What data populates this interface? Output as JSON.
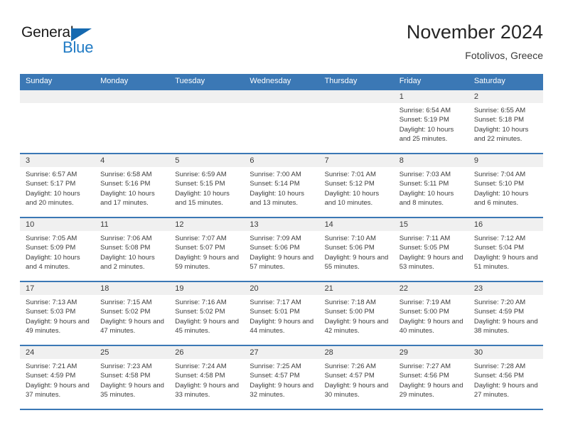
{
  "brand": {
    "name_part1": "General",
    "name_part2": "Blue"
  },
  "header": {
    "title": "November 2024",
    "location": "Fotolivos, Greece"
  },
  "colors": {
    "header_blue": "#3b78b5",
    "brand_blue": "#1f7ac4",
    "day_band": "#f0f0f0"
  },
  "weekdays": [
    "Sunday",
    "Monday",
    "Tuesday",
    "Wednesday",
    "Thursday",
    "Friday",
    "Saturday"
  ],
  "weeks": [
    [
      {
        "blank": true
      },
      {
        "blank": true
      },
      {
        "blank": true
      },
      {
        "blank": true
      },
      {
        "blank": true
      },
      {
        "day": "1",
        "sunrise": "Sunrise: 6:54 AM",
        "sunset": "Sunset: 5:19 PM",
        "daylight": "Daylight: 10 hours and 25 minutes."
      },
      {
        "day": "2",
        "sunrise": "Sunrise: 6:55 AM",
        "sunset": "Sunset: 5:18 PM",
        "daylight": "Daylight: 10 hours and 22 minutes."
      }
    ],
    [
      {
        "day": "3",
        "sunrise": "Sunrise: 6:57 AM",
        "sunset": "Sunset: 5:17 PM",
        "daylight": "Daylight: 10 hours and 20 minutes."
      },
      {
        "day": "4",
        "sunrise": "Sunrise: 6:58 AM",
        "sunset": "Sunset: 5:16 PM",
        "daylight": "Daylight: 10 hours and 17 minutes."
      },
      {
        "day": "5",
        "sunrise": "Sunrise: 6:59 AM",
        "sunset": "Sunset: 5:15 PM",
        "daylight": "Daylight: 10 hours and 15 minutes."
      },
      {
        "day": "6",
        "sunrise": "Sunrise: 7:00 AM",
        "sunset": "Sunset: 5:14 PM",
        "daylight": "Daylight: 10 hours and 13 minutes."
      },
      {
        "day": "7",
        "sunrise": "Sunrise: 7:01 AM",
        "sunset": "Sunset: 5:12 PM",
        "daylight": "Daylight: 10 hours and 10 minutes."
      },
      {
        "day": "8",
        "sunrise": "Sunrise: 7:03 AM",
        "sunset": "Sunset: 5:11 PM",
        "daylight": "Daylight: 10 hours and 8 minutes."
      },
      {
        "day": "9",
        "sunrise": "Sunrise: 7:04 AM",
        "sunset": "Sunset: 5:10 PM",
        "daylight": "Daylight: 10 hours and 6 minutes."
      }
    ],
    [
      {
        "day": "10",
        "sunrise": "Sunrise: 7:05 AM",
        "sunset": "Sunset: 5:09 PM",
        "daylight": "Daylight: 10 hours and 4 minutes."
      },
      {
        "day": "11",
        "sunrise": "Sunrise: 7:06 AM",
        "sunset": "Sunset: 5:08 PM",
        "daylight": "Daylight: 10 hours and 2 minutes."
      },
      {
        "day": "12",
        "sunrise": "Sunrise: 7:07 AM",
        "sunset": "Sunset: 5:07 PM",
        "daylight": "Daylight: 9 hours and 59 minutes."
      },
      {
        "day": "13",
        "sunrise": "Sunrise: 7:09 AM",
        "sunset": "Sunset: 5:06 PM",
        "daylight": "Daylight: 9 hours and 57 minutes."
      },
      {
        "day": "14",
        "sunrise": "Sunrise: 7:10 AM",
        "sunset": "Sunset: 5:06 PM",
        "daylight": "Daylight: 9 hours and 55 minutes."
      },
      {
        "day": "15",
        "sunrise": "Sunrise: 7:11 AM",
        "sunset": "Sunset: 5:05 PM",
        "daylight": "Daylight: 9 hours and 53 minutes."
      },
      {
        "day": "16",
        "sunrise": "Sunrise: 7:12 AM",
        "sunset": "Sunset: 5:04 PM",
        "daylight": "Daylight: 9 hours and 51 minutes."
      }
    ],
    [
      {
        "day": "17",
        "sunrise": "Sunrise: 7:13 AM",
        "sunset": "Sunset: 5:03 PM",
        "daylight": "Daylight: 9 hours and 49 minutes."
      },
      {
        "day": "18",
        "sunrise": "Sunrise: 7:15 AM",
        "sunset": "Sunset: 5:02 PM",
        "daylight": "Daylight: 9 hours and 47 minutes."
      },
      {
        "day": "19",
        "sunrise": "Sunrise: 7:16 AM",
        "sunset": "Sunset: 5:02 PM",
        "daylight": "Daylight: 9 hours and 45 minutes."
      },
      {
        "day": "20",
        "sunrise": "Sunrise: 7:17 AM",
        "sunset": "Sunset: 5:01 PM",
        "daylight": "Daylight: 9 hours and 44 minutes."
      },
      {
        "day": "21",
        "sunrise": "Sunrise: 7:18 AM",
        "sunset": "Sunset: 5:00 PM",
        "daylight": "Daylight: 9 hours and 42 minutes."
      },
      {
        "day": "22",
        "sunrise": "Sunrise: 7:19 AM",
        "sunset": "Sunset: 5:00 PM",
        "daylight": "Daylight: 9 hours and 40 minutes."
      },
      {
        "day": "23",
        "sunrise": "Sunrise: 7:20 AM",
        "sunset": "Sunset: 4:59 PM",
        "daylight": "Daylight: 9 hours and 38 minutes."
      }
    ],
    [
      {
        "day": "24",
        "sunrise": "Sunrise: 7:21 AM",
        "sunset": "Sunset: 4:59 PM",
        "daylight": "Daylight: 9 hours and 37 minutes."
      },
      {
        "day": "25",
        "sunrise": "Sunrise: 7:23 AM",
        "sunset": "Sunset: 4:58 PM",
        "daylight": "Daylight: 9 hours and 35 minutes."
      },
      {
        "day": "26",
        "sunrise": "Sunrise: 7:24 AM",
        "sunset": "Sunset: 4:58 PM",
        "daylight": "Daylight: 9 hours and 33 minutes."
      },
      {
        "day": "27",
        "sunrise": "Sunrise: 7:25 AM",
        "sunset": "Sunset: 4:57 PM",
        "daylight": "Daylight: 9 hours and 32 minutes."
      },
      {
        "day": "28",
        "sunrise": "Sunrise: 7:26 AM",
        "sunset": "Sunset: 4:57 PM",
        "daylight": "Daylight: 9 hours and 30 minutes."
      },
      {
        "day": "29",
        "sunrise": "Sunrise: 7:27 AM",
        "sunset": "Sunset: 4:56 PM",
        "daylight": "Daylight: 9 hours and 29 minutes."
      },
      {
        "day": "30",
        "sunrise": "Sunrise: 7:28 AM",
        "sunset": "Sunset: 4:56 PM",
        "daylight": "Daylight: 9 hours and 27 minutes."
      }
    ]
  ]
}
